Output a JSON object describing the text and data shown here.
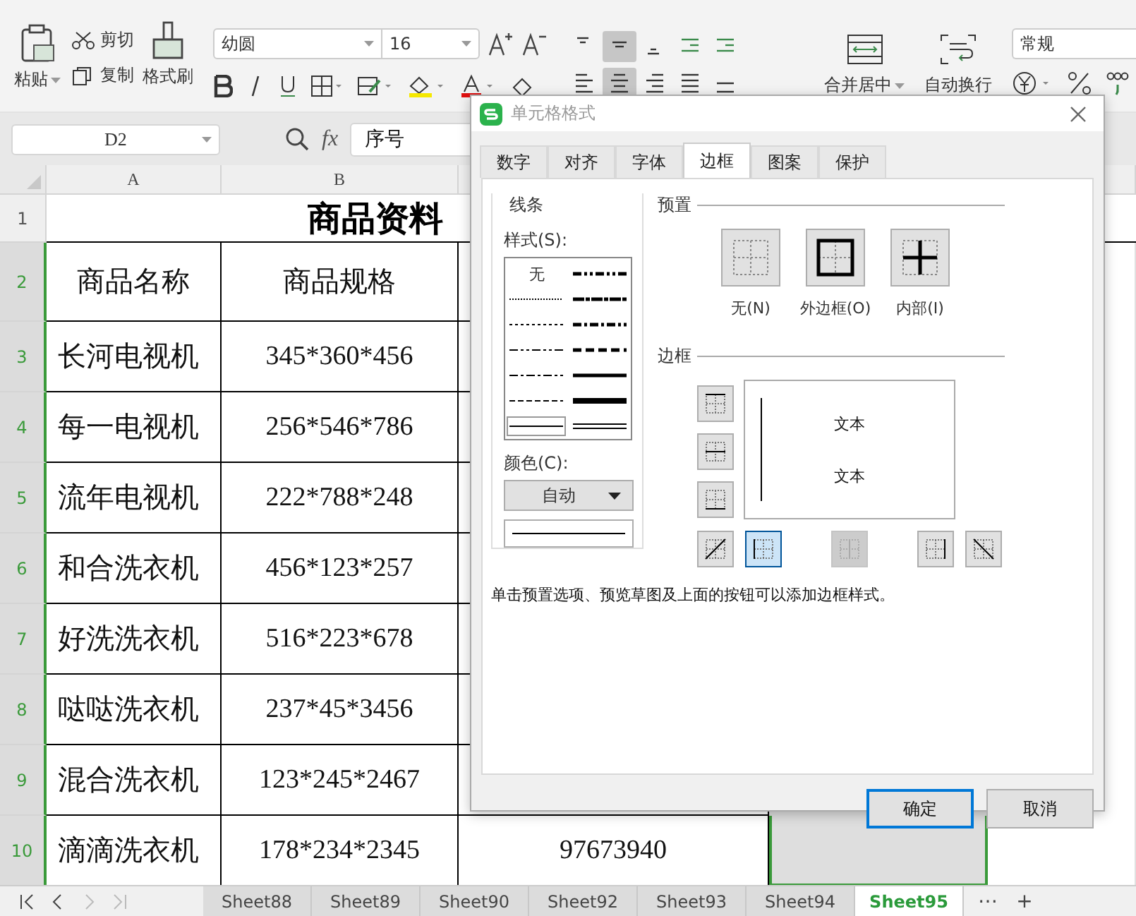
{
  "ribbon": {
    "clipboard": {
      "paste": "粘贴",
      "cut": "剪切",
      "copy": "复制",
      "format_painter": "格式刷"
    },
    "font": {
      "name": "幼圆",
      "size": "16"
    },
    "align_buttons": [
      {
        "kind": "top",
        "selected": false
      },
      {
        "kind": "middle",
        "selected": true
      },
      {
        "kind": "bottom",
        "selected": false
      },
      {
        "kind": "outdent",
        "selected": false
      },
      {
        "kind": "indent",
        "selected": false
      },
      {
        "kind": "left",
        "selected": false
      },
      {
        "kind": "center",
        "selected": true
      },
      {
        "kind": "right",
        "selected": false
      },
      {
        "kind": "justify",
        "selected": false
      },
      {
        "kind": "distribute",
        "selected": false
      }
    ],
    "merge": "合并居中",
    "wrap": "自动换行",
    "number_format": "常规"
  },
  "formula_bar": {
    "cell_ref": "D2",
    "fx": "fx",
    "value": "序号"
  },
  "columns": [
    "A",
    "B"
  ],
  "sheet": {
    "title": "商品资料",
    "headers": [
      "商品名称",
      "商品规格"
    ],
    "rows": [
      {
        "number": "2",
        "selected": true,
        "cells": []
      },
      {
        "number": "3",
        "selected": true,
        "cells": [
          "长河电视机",
          "345*360*456"
        ]
      },
      {
        "number": "4",
        "selected": true,
        "cells": [
          "每一电视机",
          "256*546*786"
        ]
      },
      {
        "number": "5",
        "selected": true,
        "cells": [
          "流年电视机",
          "222*788*248"
        ]
      },
      {
        "number": "6",
        "selected": true,
        "cells": [
          "和合洗衣机",
          "456*123*257"
        ]
      },
      {
        "number": "7",
        "selected": true,
        "cells": [
          "好洗洗衣机",
          "516*223*678"
        ]
      },
      {
        "number": "8",
        "selected": true,
        "cells": [
          "哒哒洗衣机",
          "237*45*3456"
        ]
      },
      {
        "number": "9",
        "selected": true,
        "cells": [
          "混合洗衣机",
          "123*245*2467"
        ]
      },
      {
        "number": "10",
        "selected": true,
        "cells": [
          "滴滴洗衣机",
          "178*234*2345",
          "97673940"
        ]
      }
    ],
    "title_row_number": "1"
  },
  "sheet_tabs": [
    {
      "label": "Sheet88",
      "selected": false
    },
    {
      "label": "Sheet89",
      "selected": false
    },
    {
      "label": "Sheet90",
      "selected": false
    },
    {
      "label": "Sheet92",
      "selected": false
    },
    {
      "label": "Sheet93",
      "selected": false
    },
    {
      "label": "Sheet94",
      "selected": false
    },
    {
      "label": "Sheet95",
      "selected": true
    }
  ],
  "sheet_tab_more": "⋯",
  "sheet_tab_add": "+",
  "dialog": {
    "title": "单元格格式",
    "tabs": [
      {
        "label": "数字",
        "selected": false
      },
      {
        "label": "对齐",
        "selected": false
      },
      {
        "label": "字体",
        "selected": false
      },
      {
        "label": "边框",
        "selected": true
      },
      {
        "label": "图案",
        "selected": false
      },
      {
        "label": "保护",
        "selected": false
      }
    ],
    "line_group": "线条",
    "style_label": "样式(S):",
    "none_style": "无",
    "styles": [
      {
        "kind": "none",
        "selected": false
      },
      {
        "kind": "dashdotdot-medium",
        "selected": false
      },
      {
        "kind": "hair",
        "selected": false
      },
      {
        "kind": "slant",
        "selected": false
      },
      {
        "kind": "dotted",
        "selected": false
      },
      {
        "kind": "dashdot-medium",
        "selected": false
      },
      {
        "kind": "dashdotdot",
        "selected": false
      },
      {
        "kind": "dashed-medium",
        "selected": false
      },
      {
        "kind": "dashdot",
        "selected": false
      },
      {
        "kind": "medium",
        "selected": false
      },
      {
        "kind": "dashed",
        "selected": false
      },
      {
        "kind": "thick",
        "selected": false
      },
      {
        "kind": "thin",
        "selected": true
      },
      {
        "kind": "double",
        "selected": false
      }
    ],
    "color_label": "颜色(C):",
    "color_value": "自动",
    "preset_group": "预置",
    "presets": [
      {
        "kind": "none",
        "label": "无(N)"
      },
      {
        "kind": "outline",
        "label": "外边框(O)"
      },
      {
        "kind": "inside",
        "label": "内部(I)"
      }
    ],
    "border_group": "边框",
    "preview_texts": [
      "文本",
      "文本"
    ],
    "side_buttons": [
      {
        "kind": "top",
        "selected": false
      },
      {
        "kind": "hmid",
        "selected": false
      },
      {
        "kind": "bottom",
        "selected": false
      }
    ],
    "bottom_buttons": [
      {
        "kind": "diag-up",
        "selected": false,
        "disabled": false
      },
      {
        "kind": "left",
        "selected": true,
        "disabled": false
      },
      {
        "kind": "vmid",
        "selected": false,
        "disabled": true
      },
      {
        "kind": "right",
        "selected": false,
        "disabled": false
      },
      {
        "kind": "diag-down",
        "selected": false,
        "disabled": false
      }
    ],
    "preview_left_border": true,
    "hint": "单击预置选项、预览草图及上面的按钮可以添加边框样式。",
    "buttons": [
      {
        "label": "确定",
        "kind": "default"
      },
      {
        "label": "取消",
        "kind": "normal"
      }
    ]
  }
}
